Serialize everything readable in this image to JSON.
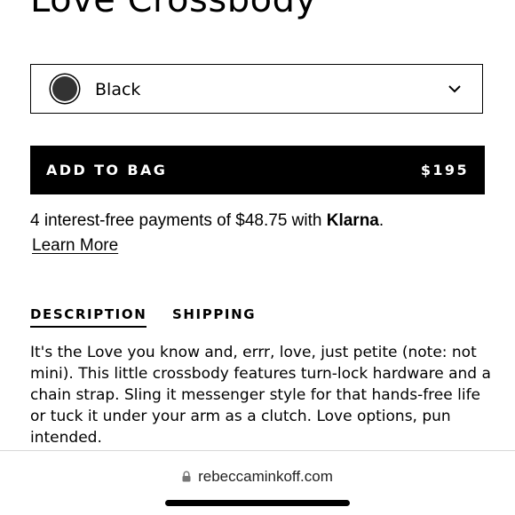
{
  "product": {
    "title": "Love Crossbody"
  },
  "color_select": {
    "selected": "Black",
    "swatch_color": "#333333"
  },
  "add_to_bag": {
    "label": "ADD TO BAG",
    "price": "$195"
  },
  "klarna": {
    "text_before": "4 interest-free payments of $48.75 with ",
    "brand": "Klarna",
    "text_after": ".",
    "learn_more": "Learn More"
  },
  "tabs": [
    {
      "label": "DESCRIPTION",
      "active": true
    },
    {
      "label": "SHIPPING",
      "active": false
    }
  ],
  "description": {
    "text": "It's the Love you know and, errr, love, just petite (note: not mini). This little crossbody features turn-lock hardware and a chain strap. Sling it messenger style for that hands-free life or tuck it under your arm as a clutch. Love options, pun intended."
  },
  "browser": {
    "url": "rebeccaminkoff.com",
    "lock_icon": "lock-icon"
  }
}
